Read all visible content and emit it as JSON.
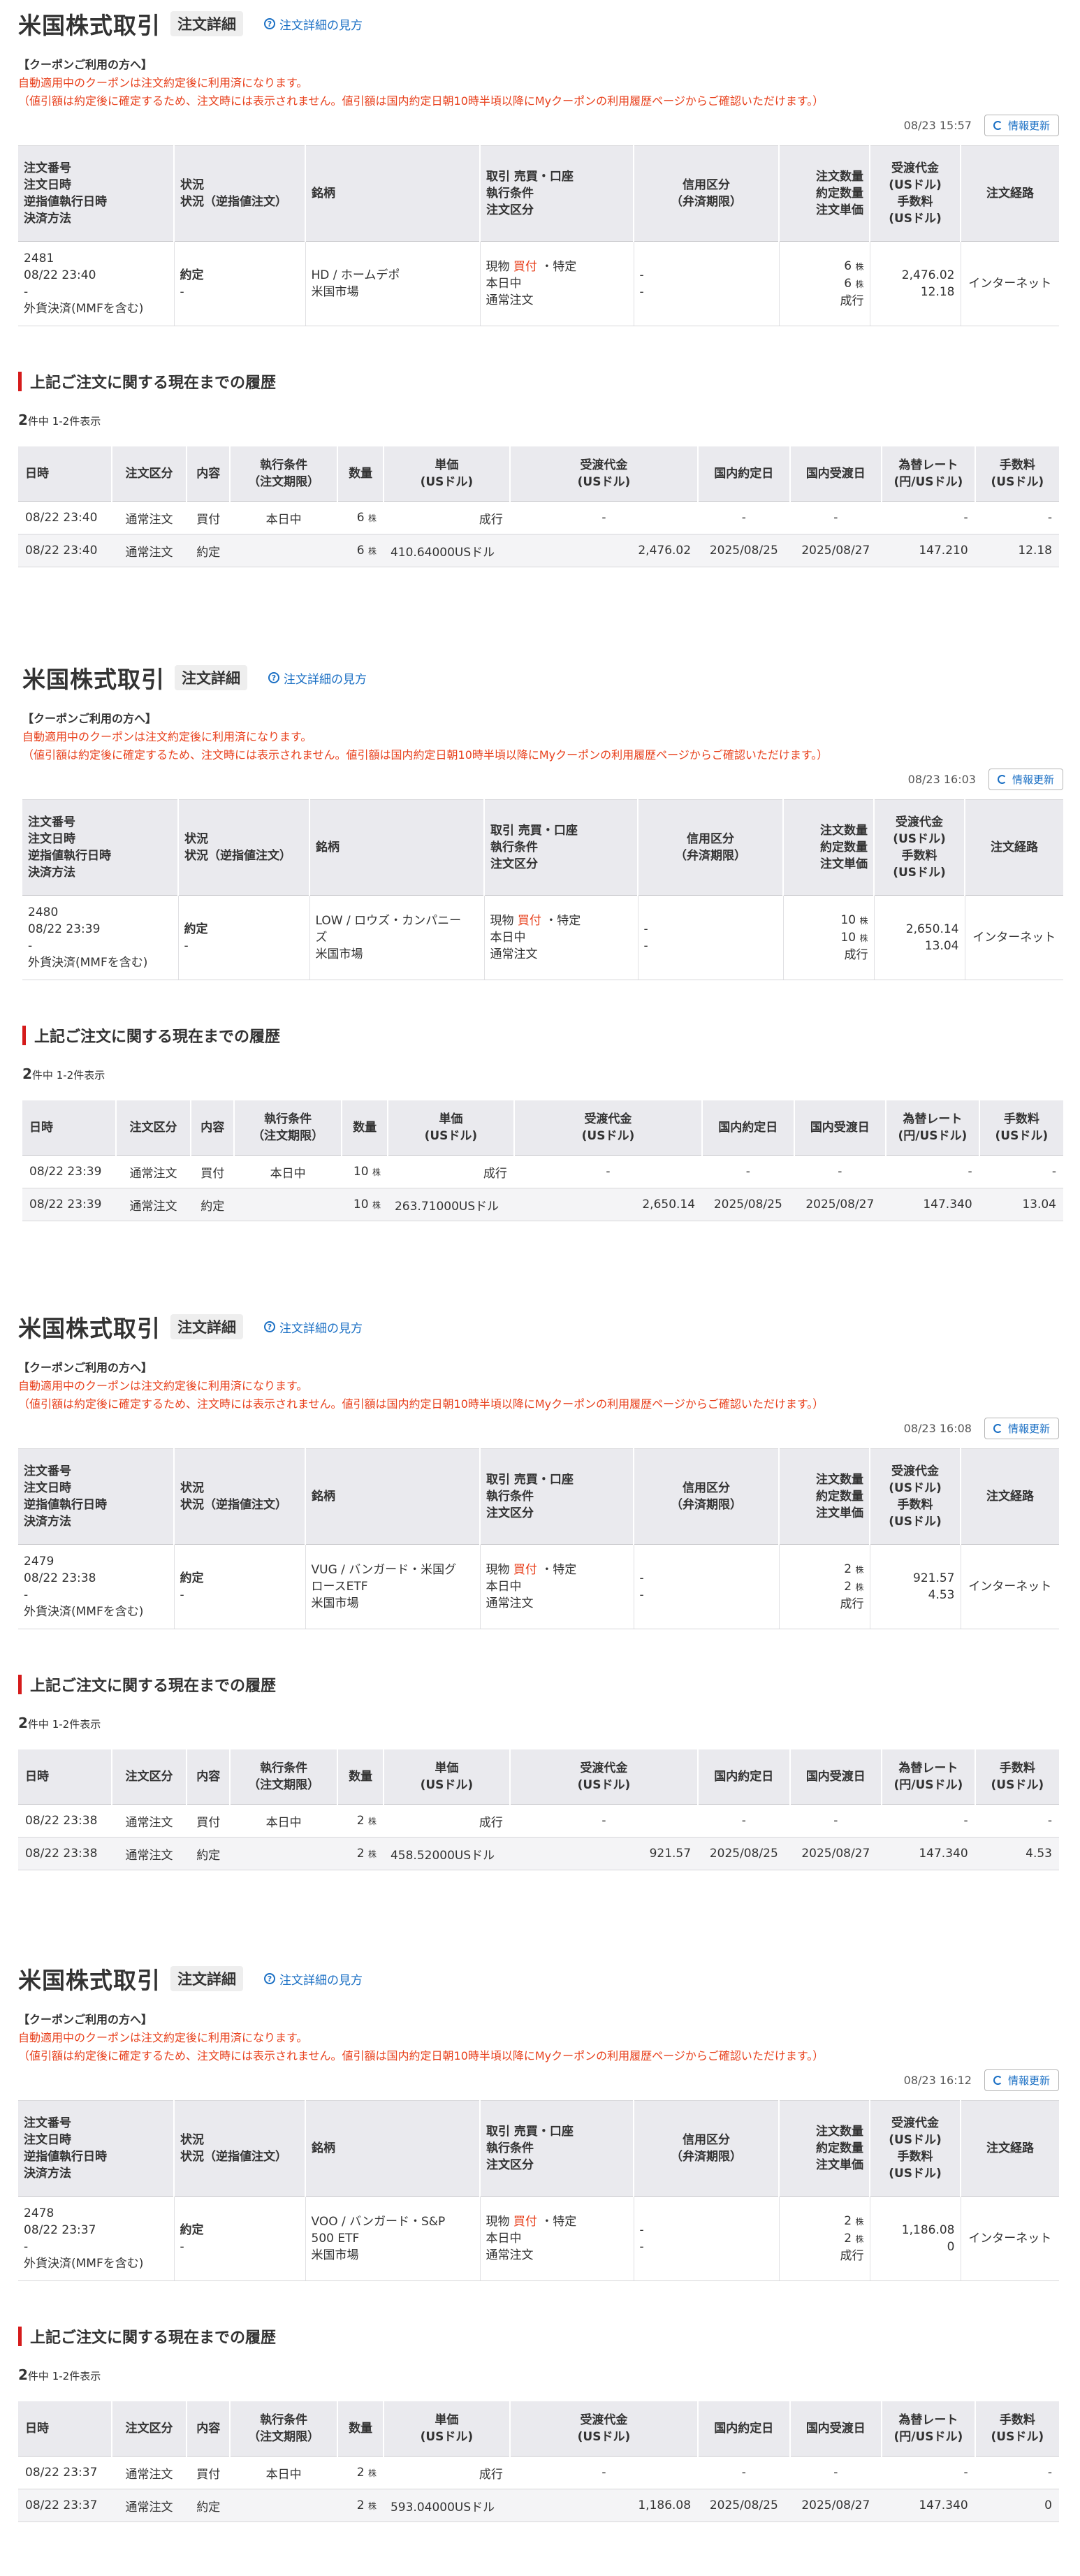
{
  "common": {
    "page_title": "米国株式取引",
    "sub_title": "注文詳細",
    "help_link": "注文詳細の見方",
    "coupon_title": "【クーポンご利用の方へ】",
    "coupon_line1": "自動適用中のクーポンは注文約定後に利用済になります。",
    "coupon_line2": "（値引額は約定後に確定するため、注文時には表示されません。値引額は国内約定日朝10時半頃以降にMyクーポンの利用履歴ページからご確認いただけます。）",
    "refresh_label": "情報更新",
    "history_title": "上記ご注文に関する現在までの履歴",
    "count_number": "2",
    "count_text": "件中 1-2件表示",
    "order_headers": {
      "col1": [
        "注文番号",
        "注文日時",
        "逆指値執行日時",
        "決済方法"
      ],
      "col2": [
        "状況",
        "状況（逆指値注文）"
      ],
      "col3": [
        "銘柄"
      ],
      "col4": [
        "取引 売買・口座",
        "執行条件",
        "注文区分"
      ],
      "col5": [
        "信用区分",
        "（弁済期限）"
      ],
      "col6": [
        "注文数量",
        "約定数量",
        "注文単価"
      ],
      "col7": [
        "受渡代金",
        "(USドル)",
        "手数料",
        "(USドル)"
      ],
      "col8": [
        "注文経路"
      ]
    },
    "history_headers": {
      "date": "日時",
      "order_type": "注文区分",
      "content": "内容",
      "condition": [
        "執行条件",
        "（注文期限）"
      ],
      "qty": "数量",
      "price": [
        "単価",
        "(USドル)"
      ],
      "amount": [
        "受渡代金",
        "(USドル)"
      ],
      "dom_exec": "国内約定日",
      "dom_settle": "国内受渡日",
      "rate": [
        "為替レート",
        "(円/USドル)"
      ],
      "fee": [
        "手数料",
        "(USドル)"
      ]
    },
    "colors": {
      "accent_red": "#e8401c",
      "link_blue": "#1a6fc4",
      "bar_red": "#d51b1b"
    }
  },
  "orders": [
    {
      "timestamp": "08/23 15:57",
      "order": {
        "number": "2481",
        "date": "08/22 23:40",
        "stop_exec": "-",
        "settlement": "外貨決済(MMFを含む)",
        "status": "約定",
        "status_stop": "-",
        "stock_line1": "HD / ホームデポ",
        "stock_line2": "",
        "market": "米国市場",
        "trade_type": "現物",
        "side": "買付",
        "account": "・特定",
        "exec_cond": "本日中",
        "order_kind": "通常注文",
        "credit1": "-",
        "credit2": "-",
        "qty_ordered": "6",
        "qty_filled": "6",
        "share_unit": "株",
        "price_kind": "成行",
        "amount": "2,476.02",
        "fee": "12.18",
        "route": "インターネット"
      },
      "history": [
        {
          "date": "08/22 23:40",
          "type": "通常注文",
          "content": "買付",
          "condition": "本日中",
          "qty": "6",
          "unit": "株",
          "price": "成行",
          "amount": "-",
          "dom_exec": "-",
          "dom_settle": "-",
          "rate": "-",
          "fee": "-"
        },
        {
          "date": "08/22 23:40",
          "type": "通常注文",
          "content": "約定",
          "condition": "",
          "qty": "6",
          "unit": "株",
          "price": "410.64000USドル",
          "amount": "2,476.02",
          "dom_exec": "2025/08/25",
          "dom_settle": "2025/08/27",
          "rate": "147.210",
          "fee": "12.18"
        }
      ]
    },
    {
      "timestamp": "08/23 16:03",
      "order": {
        "number": "2480",
        "date": "08/22 23:39",
        "stop_exec": "-",
        "settlement": "外貨決済(MMFを含む)",
        "status": "約定",
        "status_stop": "-",
        "stock_line1": "LOW / ロウズ・カンパニー",
        "stock_line2": "ズ",
        "market": "米国市場",
        "trade_type": "現物",
        "side": "買付",
        "account": "・特定",
        "exec_cond": "本日中",
        "order_kind": "通常注文",
        "credit1": "-",
        "credit2": "-",
        "qty_ordered": "10",
        "qty_filled": "10",
        "share_unit": "株",
        "price_kind": "成行",
        "amount": "2,650.14",
        "fee": "13.04",
        "route": "インターネット"
      },
      "history": [
        {
          "date": "08/22 23:39",
          "type": "通常注文",
          "content": "買付",
          "condition": "本日中",
          "qty": "10",
          "unit": "株",
          "price": "成行",
          "amount": "-",
          "dom_exec": "-",
          "dom_settle": "-",
          "rate": "-",
          "fee": "-"
        },
        {
          "date": "08/22 23:39",
          "type": "通常注文",
          "content": "約定",
          "condition": "",
          "qty": "10",
          "unit": "株",
          "price": "263.71000USドル",
          "amount": "2,650.14",
          "dom_exec": "2025/08/25",
          "dom_settle": "2025/08/27",
          "rate": "147.340",
          "fee": "13.04"
        }
      ]
    },
    {
      "timestamp": "08/23 16:08",
      "order": {
        "number": "2479",
        "date": "08/22 23:38",
        "stop_exec": "-",
        "settlement": "外貨決済(MMFを含む)",
        "status": "約定",
        "status_stop": "-",
        "stock_line1": "VUG / バンガード・米国グ",
        "stock_line2": "ロースETF",
        "market": "米国市場",
        "trade_type": "現物",
        "side": "買付",
        "account": "・特定",
        "exec_cond": "本日中",
        "order_kind": "通常注文",
        "credit1": "-",
        "credit2": "-",
        "qty_ordered": "2",
        "qty_filled": "2",
        "share_unit": "株",
        "price_kind": "成行",
        "amount": "921.57",
        "fee": "4.53",
        "route": "インターネット"
      },
      "history": [
        {
          "date": "08/22 23:38",
          "type": "通常注文",
          "content": "買付",
          "condition": "本日中",
          "qty": "2",
          "unit": "株",
          "price": "成行",
          "amount": "-",
          "dom_exec": "-",
          "dom_settle": "-",
          "rate": "-",
          "fee": "-"
        },
        {
          "date": "08/22 23:38",
          "type": "通常注文",
          "content": "約定",
          "condition": "",
          "qty": "2",
          "unit": "株",
          "price": "458.52000USドル",
          "amount": "921.57",
          "dom_exec": "2025/08/25",
          "dom_settle": "2025/08/27",
          "rate": "147.340",
          "fee": "4.53"
        }
      ]
    },
    {
      "timestamp": "08/23 16:12",
      "order": {
        "number": "2478",
        "date": "08/22 23:37",
        "stop_exec": "-",
        "settlement": "外貨決済(MMFを含む)",
        "status": "約定",
        "status_stop": "-",
        "stock_line1": "VOO / バンガード・S&P",
        "stock_line2": "500 ETF",
        "market": "米国市場",
        "trade_type": "現物",
        "side": "買付",
        "account": "・特定",
        "exec_cond": "本日中",
        "order_kind": "通常注文",
        "credit1": "-",
        "credit2": "-",
        "qty_ordered": "2",
        "qty_filled": "2",
        "share_unit": "株",
        "price_kind": "成行",
        "amount": "1,186.08",
        "fee": "0",
        "route": "インターネット"
      },
      "history": [
        {
          "date": "08/22 23:37",
          "type": "通常注文",
          "content": "買付",
          "condition": "本日中",
          "qty": "2",
          "unit": "株",
          "price": "成行",
          "amount": "-",
          "dom_exec": "-",
          "dom_settle": "-",
          "rate": "-",
          "fee": "-"
        },
        {
          "date": "08/22 23:37",
          "type": "通常注文",
          "content": "約定",
          "condition": "",
          "qty": "2",
          "unit": "株",
          "price": "593.04000USドル",
          "amount": "1,186.08",
          "dom_exec": "2025/08/25",
          "dom_settle": "2025/08/27",
          "rate": "147.340",
          "fee": "0"
        }
      ]
    }
  ]
}
